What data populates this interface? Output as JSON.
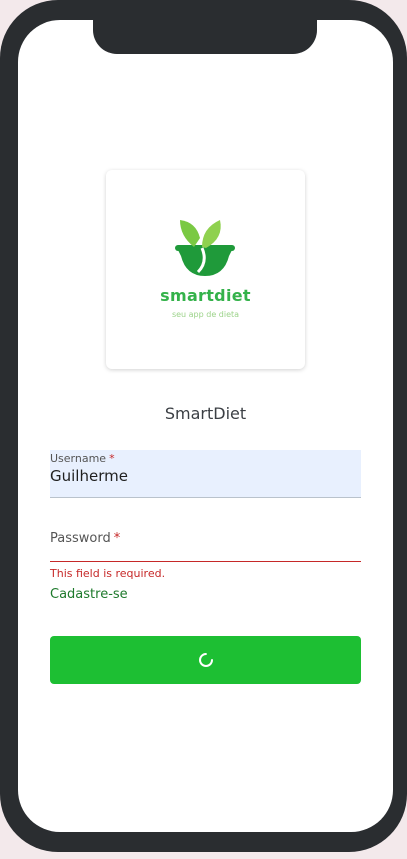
{
  "logo": {
    "brand_name": "smartdiet",
    "tagline": "seu app de dieta",
    "brand_color": "#34b24a"
  },
  "app_title": "SmartDiet",
  "form": {
    "username": {
      "label": "Username",
      "required_marker": "*",
      "value": "Guilherme"
    },
    "password": {
      "label": "Password",
      "required_marker": "*",
      "value": ""
    },
    "error_message": "This field is required.",
    "register_link": "Cadastre-se",
    "submit": {
      "state": "loading",
      "icon": "loading-spinner-icon"
    }
  },
  "colors": {
    "accent_green": "#1dbf33",
    "error_red": "#c62828",
    "link_green": "#1e7a2c",
    "autofill_bg": "#e8f0fe"
  }
}
